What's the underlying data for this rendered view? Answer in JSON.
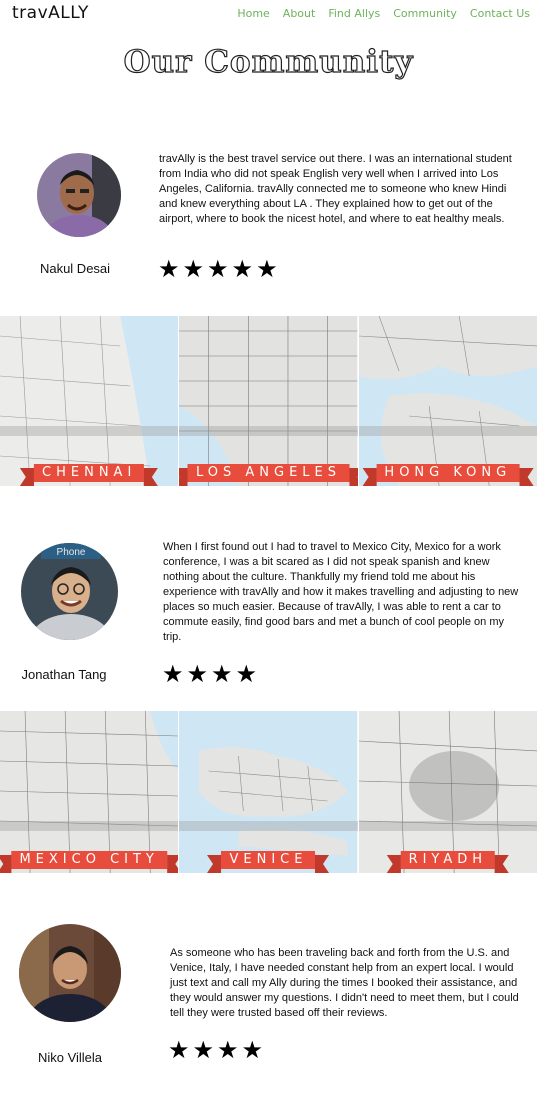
{
  "header": {
    "logo": "travALLY",
    "nav": [
      "Home",
      "About",
      "Find Allys",
      "Community",
      "Contact Us"
    ]
  },
  "page_title": "Our Community",
  "testimonials": [
    {
      "name": "Nakul Desai",
      "text": "travAlly is the best travel service out there. I was an international student from India who did not speak English very well when I arrived into Los Angeles, California. travAlly connected me to someone who knew Hindi and knew everything about LA . They explained how to get out of the airport, where to book the nicest hotel, and where to eat healthy meals.",
      "rating": 5,
      "stars": "★★★★★",
      "avatar_colors": {
        "bg": "#8a7aa0",
        "skin": "#a06b4a",
        "shirt": "#8b6aa8"
      }
    },
    {
      "name": "Jonathan Tang",
      "text": "When I first found out I had to travel to Mexico City, Mexico for a work conference, I was a bit scared as I did not speak spanish and knew nothing about the culture. Thankfully my friend told me about his experience with travAlly and how it makes travelling and adjusting to new places so much easier. Because of travAlly, I was able to rent a car to commute easily, find good bars and met a bunch of cool people on my trip.",
      "rating": 4,
      "stars": "★★★★",
      "avatar_colors": {
        "bg": "#3c4a55",
        "skin": "#d9b08c",
        "shirt": "#c9cdd1"
      }
    },
    {
      "name": "Niko Villela",
      "text": "As someone who has been traveling back and forth from the U.S. and Venice, Italy, I have needed constant help from an expert local. I would just text and call my Ally during the times I booked their assistance, and they would answer my questions. I didn't need to meet them, but I could tell they were trusted based off their reviews.",
      "rating": 4,
      "stars": "★★★★",
      "avatar_colors": {
        "bg": "#6b4a3a",
        "skin": "#c99874",
        "shirt": "#1c2233"
      }
    }
  ],
  "map_strips": [
    {
      "cities": [
        "CHENNAI",
        "LOS ANGELES",
        "HONG KONG"
      ]
    },
    {
      "cities": [
        "MEXICO CITY",
        "VENICE",
        "RIYADH"
      ]
    }
  ],
  "colors": {
    "nav": "#6db35a",
    "ribbon": "#e74c3c",
    "water": "#cfe6f5",
    "land": "#ececea"
  }
}
